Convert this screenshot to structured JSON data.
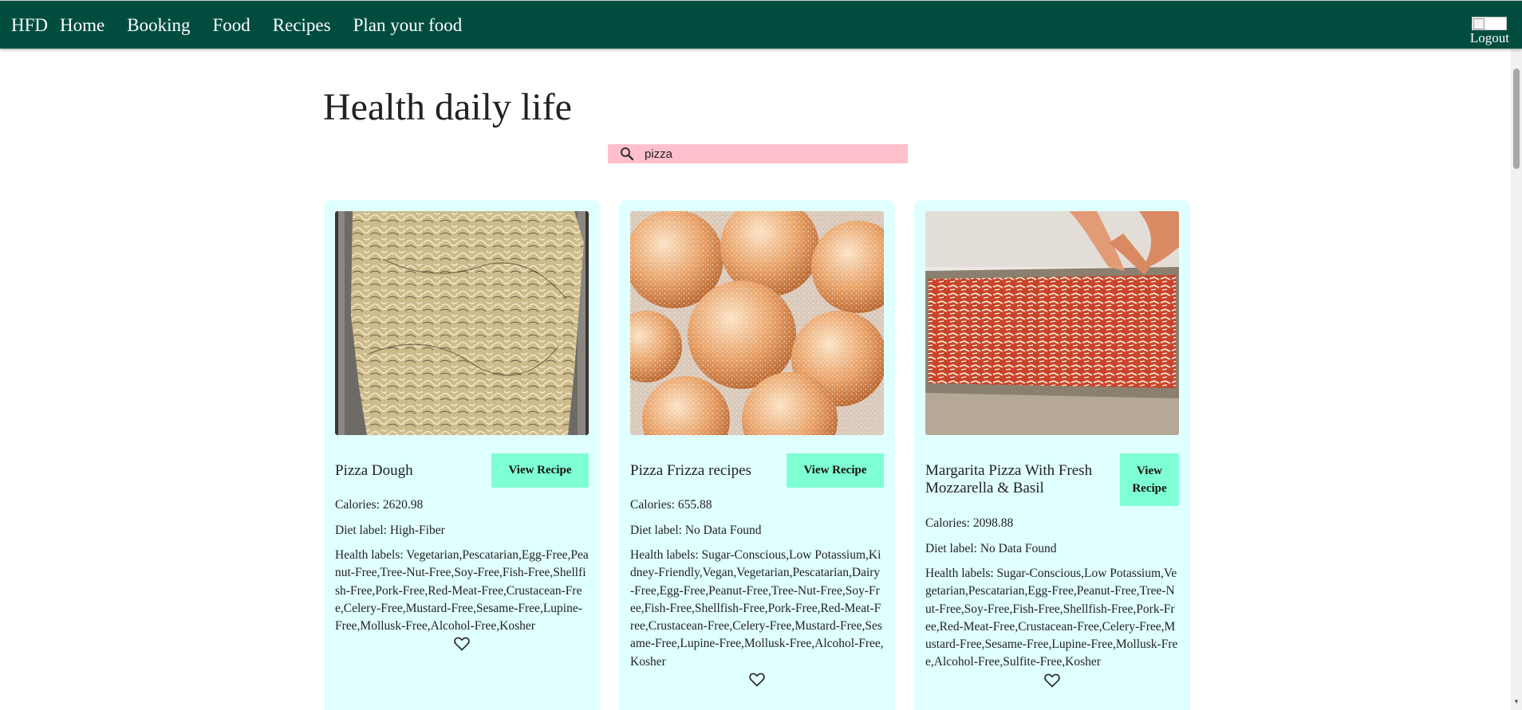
{
  "colors": {
    "navbar_bg": "#004d40",
    "card_bg": "#e0ffff",
    "button_bg": "#7fffd4",
    "search_bg": "#ffc0cb"
  },
  "navbar": {
    "brand": "HFD",
    "links": [
      "Home",
      "Booking",
      "Food",
      "Recipes",
      "Plan your food"
    ],
    "logout_label": "Logout",
    "logout_icon": "broken-image-icon"
  },
  "main": {
    "title": "Health daily life",
    "search": {
      "icon": "search-icon",
      "value": "pizza"
    },
    "recipes": [
      {
        "title": "Pizza Dough",
        "button_label": "View Recipe",
        "calories": "Calories: 2620.98",
        "diet_label": "Diet label: High-Fiber",
        "health_labels": "Health labels: Vegetarian,Pescatarian,Egg-Free,Peanut-Free,Tree-Nut-Free,Soy-Free,Fish-Free,Shellfish-Free,Pork-Free,Red-Meat-Free,Crustacean-Free,Celery-Free,Mustard-Free,Sesame-Free,Lupine-Free,Mollusk-Free,Alcohol-Free,Kosher",
        "favorite_icon": "heart-icon"
      },
      {
        "title": "Pizza Frizza recipes",
        "button_label": "View Recipe",
        "calories": "Calories: 655.88",
        "diet_label": "Diet label: No Data Found",
        "health_labels": "Health labels: Sugar-Conscious,Low Potassium,Kidney-Friendly,Vegan,Vegetarian,Pescatarian,Dairy-Free,Egg-Free,Peanut-Free,Tree-Nut-Free,Soy-Free,Fish-Free,Shellfish-Free,Pork-Free,Red-Meat-Free,Crustacean-Free,Celery-Free,Mustard-Free,Sesame-Free,Lupine-Free,Mollusk-Free,Alcohol-Free,Kosher",
        "favorite_icon": "heart-icon"
      },
      {
        "title": "Margarita Pizza With Fresh Mozzarella & Basil",
        "button_label": "View Recipe",
        "calories": "Calories: 2098.88",
        "diet_label": "Diet label: No Data Found",
        "health_labels": "Health labels: Sugar-Conscious,Low Potassium,Vegetarian,Pescatarian,Egg-Free,Peanut-Free,Tree-Nut-Free,Soy-Free,Fish-Free,Shellfish-Free,Pork-Free,Red-Meat-Free,Crustacean-Free,Celery-Free,Mustard-Free,Sesame-Free,Lupine-Free,Mollusk-Free,Alcohol-Free,Sulfite-Free,Kosher",
        "favorite_icon": "heart-icon"
      }
    ]
  }
}
